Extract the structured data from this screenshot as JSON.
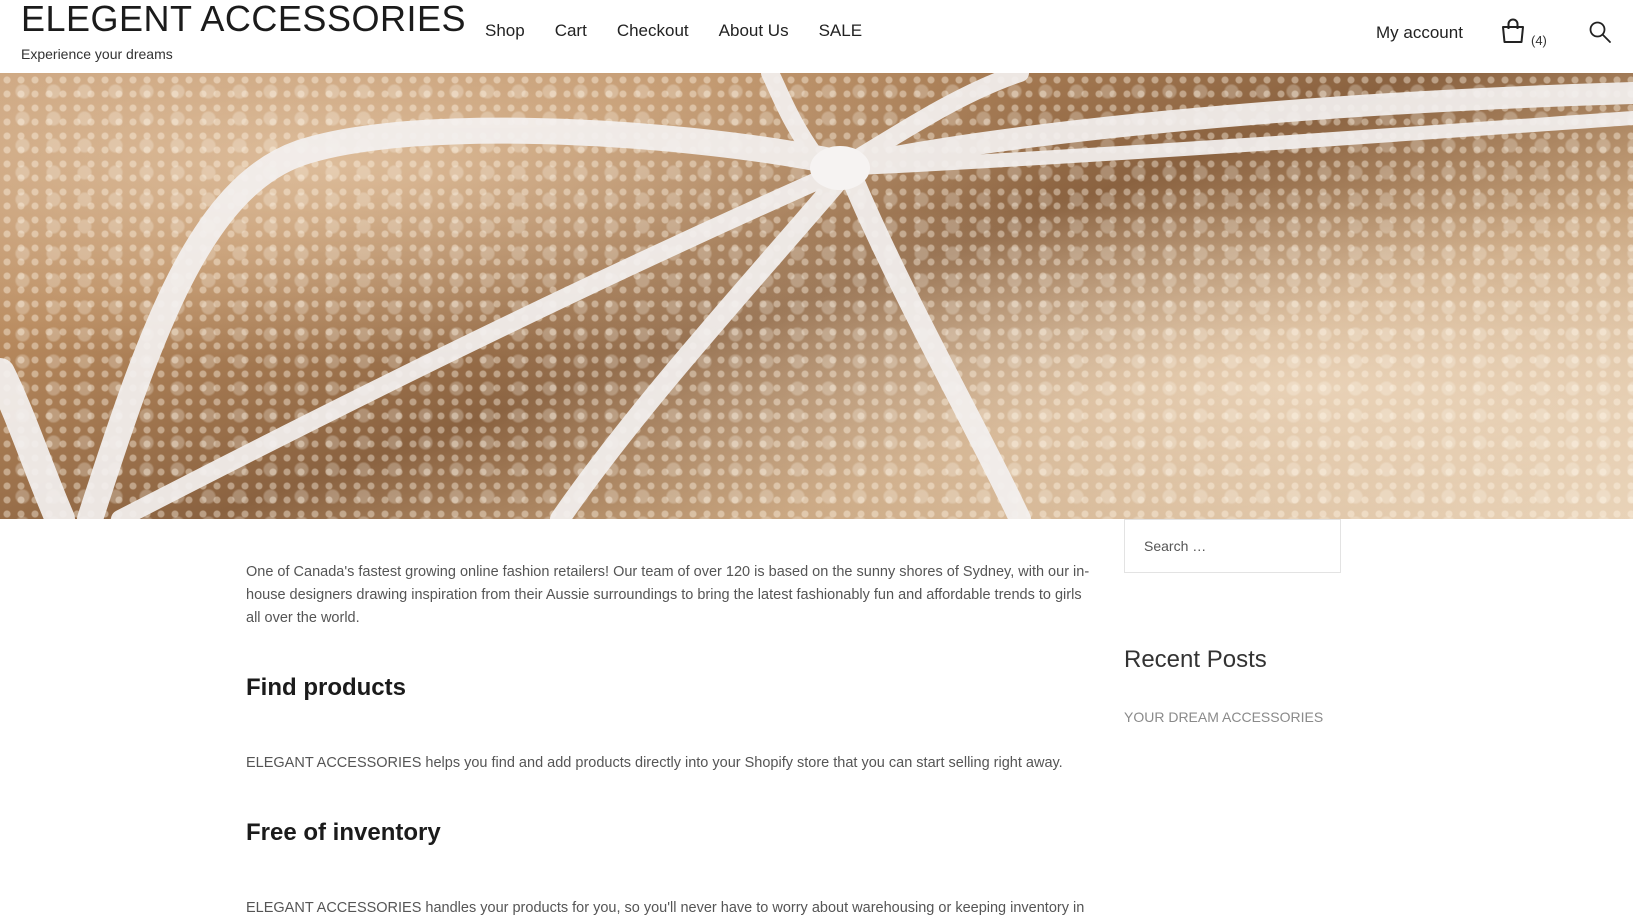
{
  "site": {
    "title": "ELEGENT ACCESSORIES",
    "tagline": "Experience your dreams"
  },
  "nav": {
    "items": [
      {
        "label": "Shop"
      },
      {
        "label": "Cart"
      },
      {
        "label": "Checkout"
      },
      {
        "label": "About Us"
      },
      {
        "label": "SALE"
      }
    ]
  },
  "header_actions": {
    "account_label": "My account",
    "cart_count": "(4)",
    "cart_icon": "shopping-bag-icon",
    "search_icon": "search-icon"
  },
  "hero": {
    "image": "gold-glitter-gift-with-white-ribbon"
  },
  "main": {
    "intro": "One of Canada's fastest growing online fashion retailers! Our team of over 120 is based on the sunny shores of Sydney, with our in-house designers drawing inspiration from their Aussie surroundings to bring the latest fashionably fun and affordable trends to girls all over the world.",
    "sections": [
      {
        "heading": "Find products",
        "text": "ELEGANT ACCESSORIES helps you find and add products directly into your Shopify store that you can start selling right away."
      },
      {
        "heading": "Free of inventory",
        "text": "ELEGANT ACCESSORIES handles your products for you, so you'll never have to worry about warehousing or keeping inventory in"
      }
    ]
  },
  "sidebar": {
    "search_placeholder": "Search …",
    "recent_posts_title": "Recent Posts",
    "recent_posts": [
      {
        "label": "YOUR DREAM ACCESSORIES"
      }
    ]
  }
}
